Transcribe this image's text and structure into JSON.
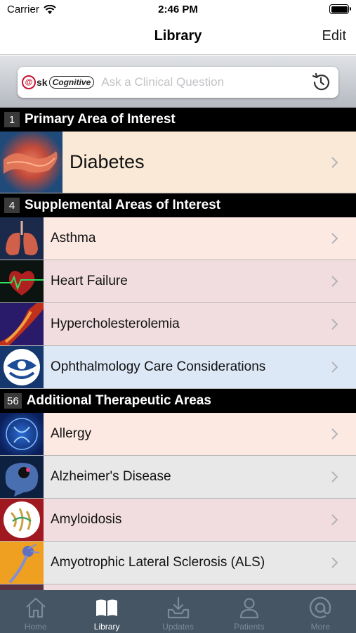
{
  "status_bar": {
    "carrier": "Carrier",
    "time": "2:46 PM"
  },
  "nav": {
    "title": "Library",
    "edit_label": "Edit"
  },
  "search": {
    "logo_q": "@",
    "logo_sk": "sk",
    "logo_cognitive": "Cognitive",
    "placeholder": "Ask a Clinical Question"
  },
  "sections": {
    "primary": {
      "count": "1",
      "title": "Primary Area of Interest",
      "items": [
        {
          "label": "Diabetes",
          "thumb": "pancreas-image",
          "bg": "#f9e9d6"
        }
      ]
    },
    "supplemental": {
      "count": "4",
      "title": "Supplemental Areas of Interest",
      "items": [
        {
          "label": "Asthma",
          "thumb": "lungs-image",
          "bg": "#fbe9e2"
        },
        {
          "label": "Heart Failure",
          "thumb": "heart-image",
          "bg": "#f1dde0"
        },
        {
          "label": "Hypercholesterolemia",
          "thumb": "artery-image",
          "bg": "#f1dde0"
        },
        {
          "label": "Ophthalmology Care Considerations",
          "thumb": "eye-care-logo",
          "bg": "#dde8f7"
        }
      ]
    },
    "additional": {
      "count": "56",
      "title": "Additional Therapeutic Areas",
      "items": [
        {
          "label": "Allergy",
          "thumb": "allergy-image",
          "bg": "#fbe9e2"
        },
        {
          "label": "Alzheimer's Disease",
          "thumb": "brain-image",
          "bg": "#e8e8e8"
        },
        {
          "label": "Amyloidosis",
          "thumb": "protein-image",
          "bg": "#f1dde0"
        },
        {
          "label": "Amyotrophic Lateral Sclerosis (ALS)",
          "thumb": "neuron-image",
          "bg": "#e8e8e8"
        }
      ]
    }
  },
  "tab_bar": {
    "tabs": [
      {
        "label": "Home",
        "icon": "home-icon",
        "active": false
      },
      {
        "label": "Library",
        "icon": "book-icon",
        "active": true
      },
      {
        "label": "Updates",
        "icon": "inbox-download-icon",
        "active": false
      },
      {
        "label": "Patients",
        "icon": "person-icon",
        "active": false
      },
      {
        "label": "More",
        "icon": "at-sign-icon",
        "active": false
      }
    ]
  },
  "colors": {
    "tab_bar_bg": "#455563",
    "tab_inactive": "#7b8a97",
    "tab_active": "#ffffff",
    "section_header_bg": "#000000"
  }
}
